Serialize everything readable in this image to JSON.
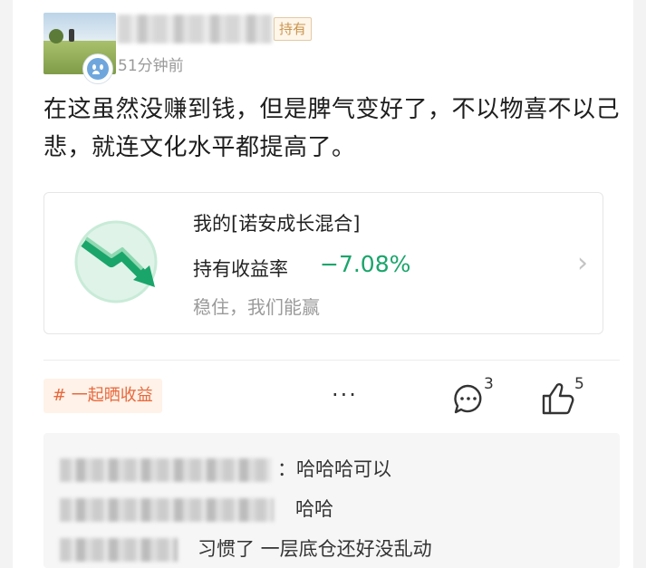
{
  "post": {
    "holding_tag": "持有",
    "time": "51分钟前",
    "text": "在这虽然没赚到钱，但是脾气变好了，不以物喜不以己悲，就连文化水平都提高了。"
  },
  "fund": {
    "title": "我的[诺安成长混合]",
    "rate_label": "持有收益率",
    "rate_value": "−7.08%",
    "slogan": "稳住，我们能赢",
    "icon": "down-trend-arrow-icon",
    "rate_color": "#1aa56b"
  },
  "actions": {
    "topic": "# 一起晒收益",
    "more": "···",
    "comment_count": "3",
    "like_count": "5"
  },
  "comments": [
    {
      "text": "：哈哈哈可以"
    },
    {
      "text": "哈哈"
    },
    {
      "text": "习惯了 一层底仓还好没乱动"
    }
  ],
  "colors": {
    "accent_orange": "#e8683c",
    "tag_gold": "#c99550",
    "gain_green": "#1aa56b"
  }
}
